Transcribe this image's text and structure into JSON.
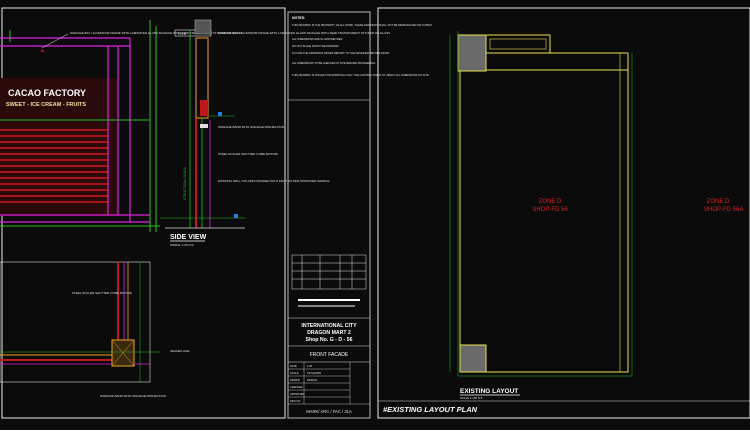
{
  "facade": {
    "brand_title": "CACAO FACTORY",
    "brand_subtitle": "SWEET - ICE CREAM - FRUITS",
    "callouts": {
      "signage_top": "SIGNAGE BAY / ALUMINIUM FRAME WITH LAMINATED GLASS SIGNAGE WITH SEMI-TRANSPARENT STICKER ON GLASS",
      "signage_side": "SIGNAGE BAY / ALUMINIUM FRAME WITH LAMINATED GLASS SIGNAGE WITH SEMI-TRANSPARENT STICKER ON GLASS",
      "signage_band": "SIGNAGE BAND WITH SIGNAGE PROJECTION",
      "roller_shutter": "STEEL ROLLER SHUTTER (TUBE MOTOR)",
      "existing_wall": "EXISTING WALL COLUMN FINISHED WITH PAINT AS PER APPROVED SAMPLE",
      "structural_glass": "STRUCTURAL GLASS",
      "roller_shutter_plan": "STEEL ROLLER SHUTTER (TUBE MOTOR)",
      "sealed_line": "SEALED LINE",
      "signage_band_plan": "SIGNAGE BAND WITH SIGNAGE PROJECTION"
    },
    "side_view_title": "SIDE VIEW",
    "side_view_scale": "SIGNAL 1:25 N.S",
    "section_tag": "P.D.D"
  },
  "notes": {
    "heading": "NOTES:",
    "items": [
      "THIS DRAWING IS THE PROPERTY OF ALL WORK. THESE DRAWINGS SHALL NOT BE REPRODUCED OR COPIED.",
      "ALL DIMENSIONS ARE IN CENTIMETRES.",
      "DO NOT SCALE FROM THE DRAWING.",
      "IN CASE THE DRAWINGS DIFFER REPORT TO THE DESIGNER BEFORE WORK.",
      "ALL DIMENSIONS TO BE CHECKED AT SITE BEFORE PROCEEDING.",
      "THIS DRAWING IS ISSUED FOR APPROVAL ONLY. THE CONTRACTOR IS TO VERIFY ALL DIMENSIONS ON SITE."
    ]
  },
  "title_block": {
    "project_line1": "INTERNATIONAL CITY",
    "project_line2": "DRAGON MART 2",
    "project_line3": "Shop No. G - D - 56",
    "sheet_title": "FRONT FACADE",
    "rows": [
      {
        "label": "DATE",
        "value": "1:25"
      },
      {
        "label": "SCALE",
        "value": "AS SHOWN"
      },
      {
        "label": "DRAWN",
        "value": "DESIGN"
      },
      {
        "label": "CHECKED",
        "value": ""
      },
      {
        "label": "APPROVED",
        "value": ""
      },
      {
        "label": "DRG NO.",
        "value": ""
      }
    ],
    "drawing_number": "MARK/ ARC / FAC / 31A"
  },
  "layout": {
    "zone_label_left": "ZONE D",
    "shop_label_left": "SHOP-FD 56",
    "zone_label_right": "ZONE D",
    "shop_label_right": "SHOP-FD 56A",
    "plan_title": "EXISTING LAYOUT",
    "plan_scale": "SCALE 1:100 N.S",
    "sheet_banner": "#EXISTING LAYOUT PLAN"
  }
}
